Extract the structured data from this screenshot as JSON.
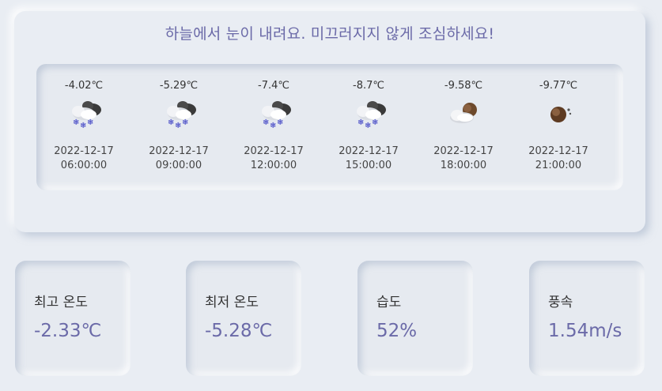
{
  "headline": "하늘에서 눈이 내려요. 미끄러지지 않게 조심하세요!",
  "forecast": [
    {
      "temp": "-4.02℃",
      "icon": "snow-cloud-icon",
      "date": "2022-12-17",
      "time": "06:00:00"
    },
    {
      "temp": "-5.29℃",
      "icon": "snow-cloud-icon",
      "date": "2022-12-17",
      "time": "09:00:00"
    },
    {
      "temp": "-7.4℃",
      "icon": "snow-cloud-icon",
      "date": "2022-12-17",
      "time": "12:00:00"
    },
    {
      "temp": "-8.7℃",
      "icon": "snow-cloud-icon",
      "date": "2022-12-17",
      "time": "15:00:00"
    },
    {
      "temp": "-9.58℃",
      "icon": "moon-cloud-icon",
      "date": "2022-12-17",
      "time": "18:00:00"
    },
    {
      "temp": "-9.77℃",
      "icon": "moon-icon",
      "date": "2022-12-17",
      "time": "21:00:00"
    }
  ],
  "stats": {
    "max_temp": {
      "label": "최고 온도",
      "value": "-2.33℃"
    },
    "min_temp": {
      "label": "최저 온도",
      "value": "-5.28℃"
    },
    "humidity": {
      "label": "습도",
      "value": "52%"
    },
    "wind": {
      "label": "풍속",
      "value": "1.54m/s"
    }
  },
  "colors": {
    "accent": "#6b6aa8",
    "background": "#e9edf3",
    "text": "#333333"
  }
}
